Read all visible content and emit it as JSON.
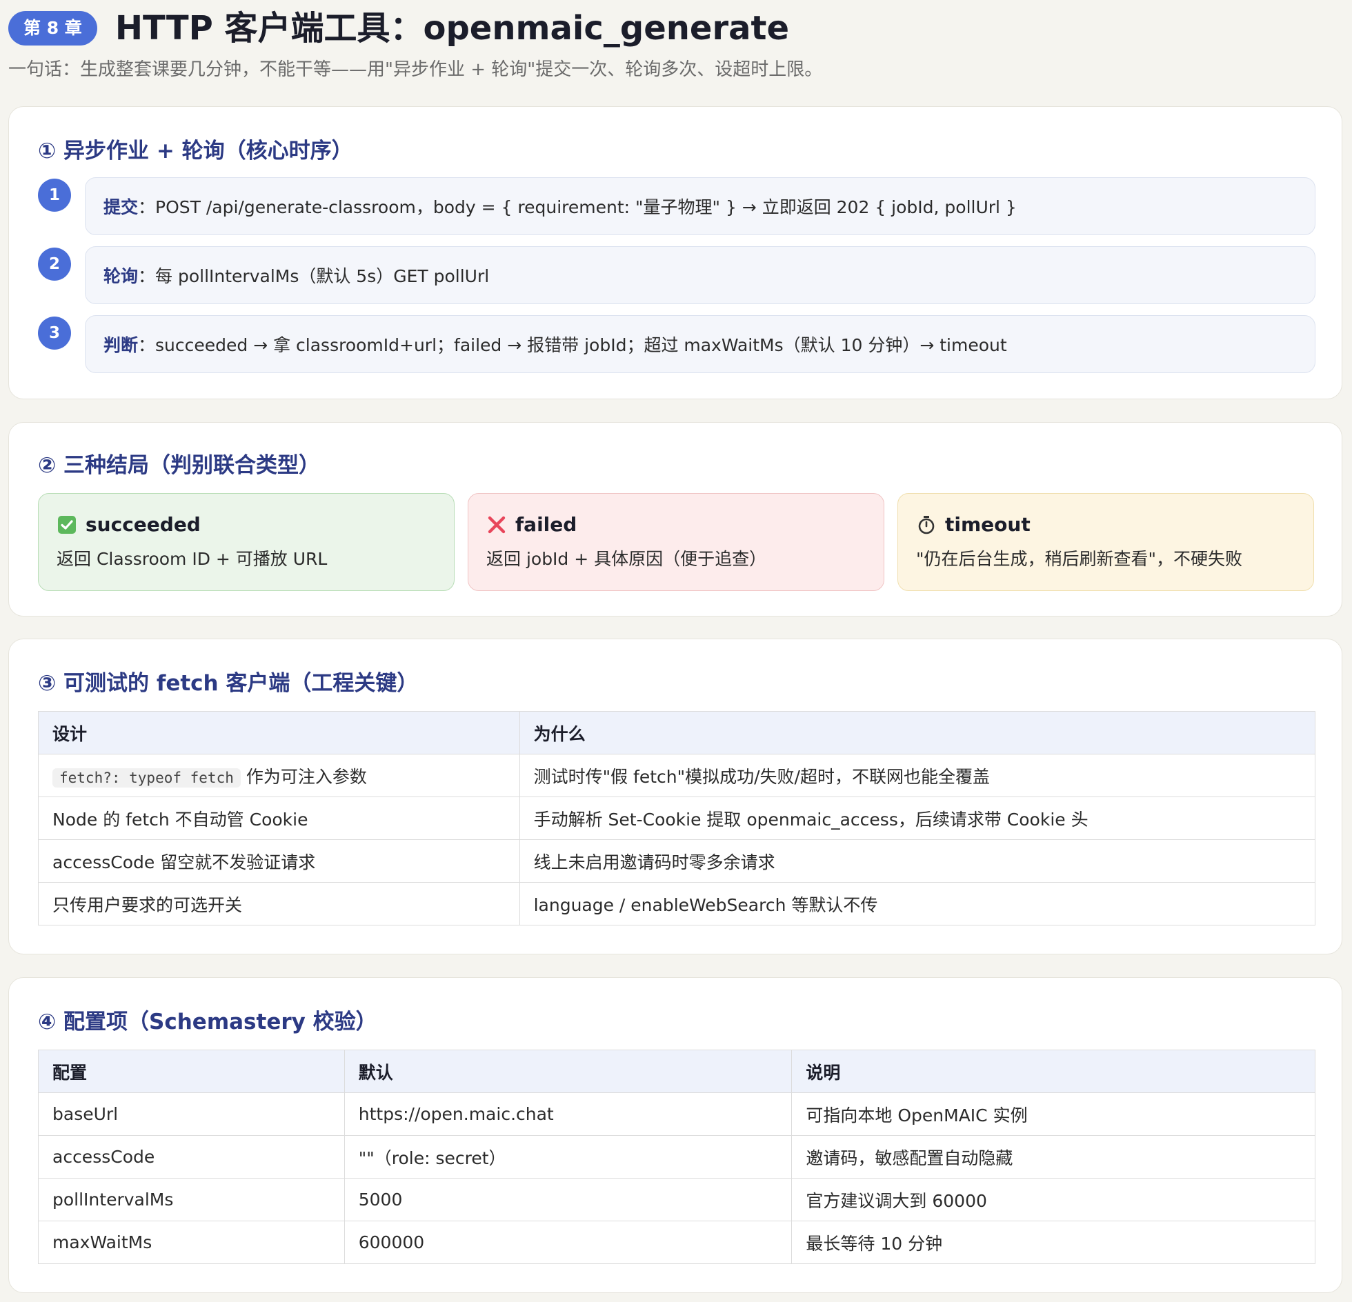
{
  "header": {
    "chapter": "第 8 章",
    "title": "HTTP 客户端工具：openmaic_generate",
    "subtitle": "一句话：生成整套课要几分钟，不能干等——用\"异步作业 + 轮询\"提交一次、轮询多次、设超时上限。"
  },
  "section1": {
    "title": "① 异步作业 + 轮询（核心时序）",
    "steps": [
      {
        "num": "1",
        "label": "提交",
        "text": "：POST /api/generate-classroom，body = { requirement: \"量子物理\" } → 立即返回 202 { jobId, pollUrl }"
      },
      {
        "num": "2",
        "label": "轮询",
        "text": "：每 pollIntervalMs（默认 5s）GET pollUrl"
      },
      {
        "num": "3",
        "label": "判断",
        "text": "：succeeded → 拿 classroomId+url；failed → 报错带 jobId；超过 maxWaitMs（默认 10 分钟）→ timeout"
      }
    ]
  },
  "section2": {
    "title": "② 三种结局（判别联合类型）",
    "outcomes": [
      {
        "icon": "check-icon",
        "name": "succeeded",
        "desc": "返回 Classroom ID + 可播放 URL",
        "color": "#5cb85c"
      },
      {
        "icon": "cross-icon",
        "name": "failed",
        "desc": "返回 jobId + 具体原因（便于追查）",
        "color": "#e8455a"
      },
      {
        "icon": "stopwatch-icon",
        "name": "timeout",
        "desc": "\"仍在后台生成，稍后刷新查看\"，不硬失败",
        "color": "#333333"
      }
    ]
  },
  "section3": {
    "title": "③ 可测试的 fetch 客户端（工程关键）",
    "headers": [
      "设计",
      "为什么"
    ],
    "rows": [
      {
        "code": "fetch?: typeof fetch",
        "design": " 作为可注入参数",
        "why": "测试时传\"假 fetch\"模拟成功/失败/超时，不联网也能全覆盖"
      },
      {
        "design": "Node 的 fetch 不自动管 Cookie",
        "why": "手动解析 Set-Cookie 提取 openmaic_access，后续请求带 Cookie 头"
      },
      {
        "design": "accessCode 留空就不发验证请求",
        "why": "线上未启用邀请码时零多余请求"
      },
      {
        "design": "只传用户要求的可选开关",
        "why": "language / enableWebSearch 等默认不传"
      }
    ]
  },
  "section4": {
    "title": "④ 配置项（Schemastery 校验）",
    "headers": [
      "配置",
      "默认",
      "说明"
    ],
    "rows": [
      [
        "baseUrl",
        "https://open.maic.chat",
        "可指向本地 OpenMAIC 实例"
      ],
      [
        "accessCode",
        "\"\"（role: secret）",
        "邀请码，敏感配置自动隐藏"
      ],
      [
        "pollIntervalMs",
        "5000",
        "官方建议调大到 60000"
      ],
      [
        "maxWaitMs",
        "600000",
        "最长等待 10 分钟"
      ]
    ]
  },
  "colors": {
    "accent": "#4a6ed8",
    "section_title": "#2c3a84",
    "background": "#f5f4ef"
  }
}
